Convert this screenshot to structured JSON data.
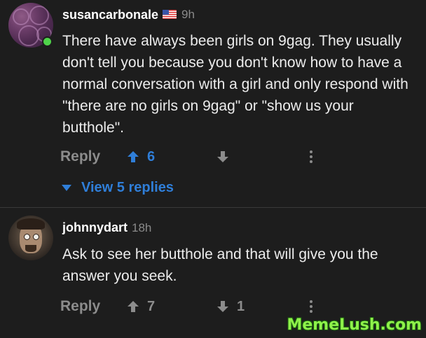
{
  "comments": [
    {
      "username": "susancarbonale",
      "time": "9h",
      "text": "There have always been girls on 9gag. They usually don't tell you because you don't know how to have a normal conversation with a girl and only respond with \"there are no girls on 9gag\" or \"show us your butthole\".",
      "reply_label": "Reply",
      "upvotes": "6",
      "downvotes": "",
      "view_replies": "View 5 replies",
      "online": true
    },
    {
      "username": "johnnydart",
      "time": "18h",
      "text": "Ask to see her butthole and that will give you the answer you seek.",
      "reply_label": "Reply",
      "upvotes": "7",
      "downvotes": "1"
    }
  ],
  "colors": {
    "background": "#1d1d1d",
    "accent": "#2f7ed8",
    "muted": "#8c8c8c",
    "online": "#4fd34a"
  },
  "watermark": "MemeLush.com"
}
